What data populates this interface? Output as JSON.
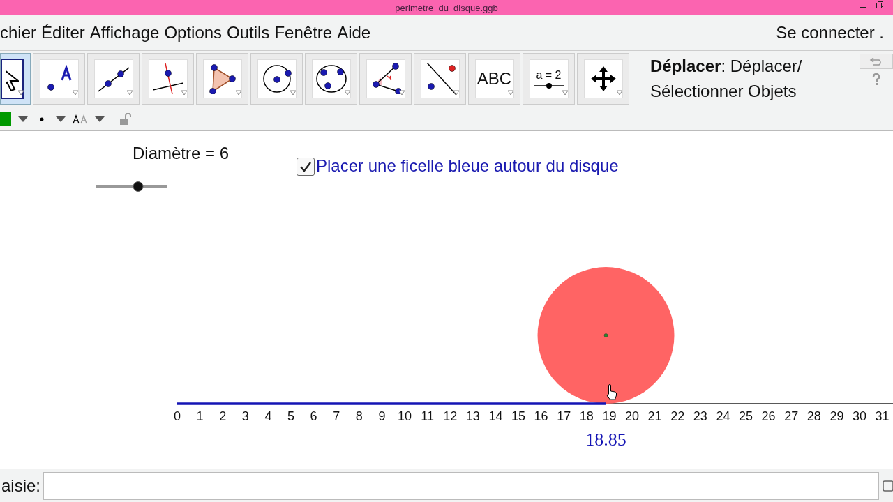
{
  "window": {
    "title": "perimetre_du_disque.ggb"
  },
  "menu": [
    "chier",
    "Éditer",
    "Affichage",
    "Options",
    "Outils",
    "Fenêtre",
    "Aide"
  ],
  "login": "Se connecter .",
  "tools": [
    {
      "kind": "move",
      "selected": true
    },
    {
      "kind": "point",
      "selected": false
    },
    {
      "kind": "line",
      "selected": false
    },
    {
      "kind": "perpendicular",
      "selected": false
    },
    {
      "kind": "polygon",
      "selected": false
    },
    {
      "kind": "circle",
      "selected": false
    },
    {
      "kind": "conic",
      "selected": false
    },
    {
      "kind": "angle",
      "selected": false
    },
    {
      "kind": "reflect",
      "selected": false
    },
    {
      "kind": "text",
      "label": "ABC",
      "selected": false
    },
    {
      "kind": "slider",
      "label": "a = 2",
      "selected": false
    },
    {
      "kind": "pan",
      "selected": false
    }
  ],
  "tool_help": "**Déplacer**: Déplacer/ Sélectionner Objets",
  "style_bar": {
    "color": "#009900"
  },
  "slider": {
    "label": "Diamètre = 6",
    "level": 0.59
  },
  "checkbox": {
    "label": "Placer une ficelle bleue autour du disque",
    "checked": true
  },
  "axis": {
    "ticks": [
      "0",
      "1",
      "2",
      "3",
      "4",
      "5",
      "6",
      "7",
      "8",
      "9",
      "10",
      "11",
      "12",
      "13",
      "14",
      "15",
      "16",
      "17",
      "18",
      "19",
      "20",
      "21",
      "22",
      "23",
      "24",
      "25",
      "26",
      "27",
      "28",
      "29",
      "30",
      "31"
    ]
  },
  "perimeter_label": "18.85",
  "input_bar": {
    "label": "aisie:"
  }
}
